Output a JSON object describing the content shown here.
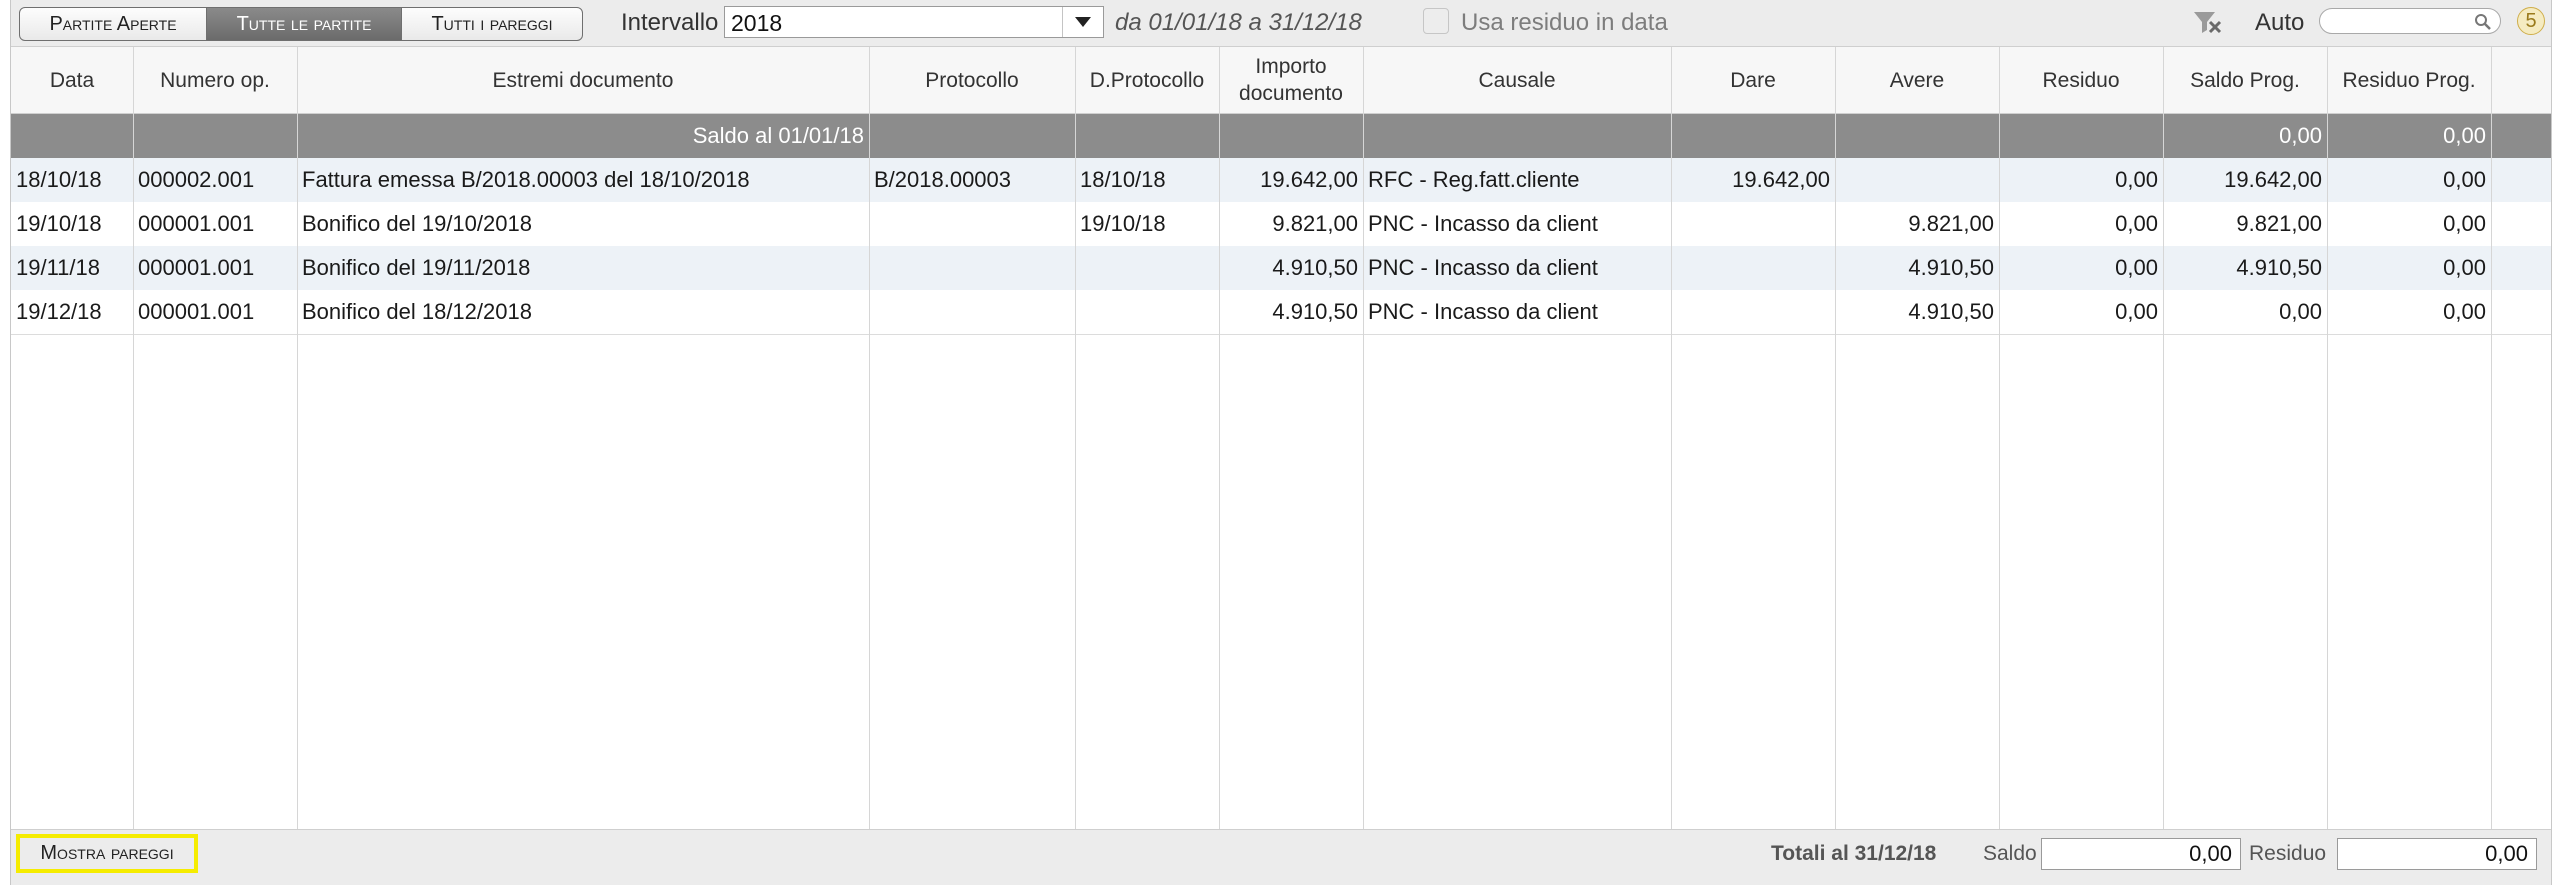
{
  "toolbar": {
    "segments": [
      "Partite Aperte",
      "Tutte le partite",
      "Tutti i pareggi"
    ],
    "active_segment": 1,
    "intervallo_label": "Intervallo",
    "intervallo_value": "2018",
    "range_text": "da 01/01/18 a 31/12/18",
    "checkbox_label": "Usa residuo in data",
    "checkbox_checked": false,
    "auto_label": "Auto",
    "search_value": "",
    "badge": "5"
  },
  "table": {
    "columns": [
      "Data",
      "Numero op.",
      "Estremi documento",
      "Protocollo",
      "D.Protocollo",
      "Importo documento",
      "Causale",
      "Dare",
      "Avere",
      "Residuo",
      "Saldo Prog.",
      "Residuo Prog."
    ],
    "saldo_row": {
      "label": "Saldo al 01/01/18",
      "saldo_prog": "0,00",
      "residuo_prog": "0,00"
    },
    "rows": [
      [
        "18/10/18",
        "000002.001",
        "Fattura emessa B/2018.00003 del 18/10/2018",
        "B/2018.00003",
        "18/10/18",
        "19.642,00",
        "RFC - Reg.fatt.cliente",
        "19.642,00",
        "",
        "0,00",
        "19.642,00",
        "0,00"
      ],
      [
        "19/10/18",
        "000001.001",
        "Bonifico del 19/10/2018",
        "",
        "19/10/18",
        "9.821,00",
        "PNC - Incasso da client",
        "",
        "9.821,00",
        "0,00",
        "9.821,00",
        "0,00"
      ],
      [
        "19/11/18",
        "000001.001",
        "Bonifico del 19/11/2018",
        "",
        "",
        "4.910,50",
        "PNC - Incasso da client",
        "",
        "4.910,50",
        "0,00",
        "4.910,50",
        "0,00"
      ],
      [
        "19/12/18",
        "000001.001",
        "Bonifico del 18/12/2018",
        "",
        "",
        "4.910,50",
        "PNC - Incasso da client",
        "",
        "4.910,50",
        "0,00",
        "0,00",
        "0,00"
      ]
    ]
  },
  "footer": {
    "mostra_pareggi": "Mostra pareggi",
    "totali_label": "Totali al 31/12/18",
    "saldo_label": "Saldo",
    "saldo_value": "0,00",
    "residuo_label": "Residuo",
    "residuo_value": "0,00"
  },
  "colors": {
    "active_segment": "#7a7a7a",
    "saldo_row": "#8c8c8c",
    "alt_row": "#edf2f7",
    "highlight": "#f5ec00",
    "badge": "#cfae4a"
  }
}
